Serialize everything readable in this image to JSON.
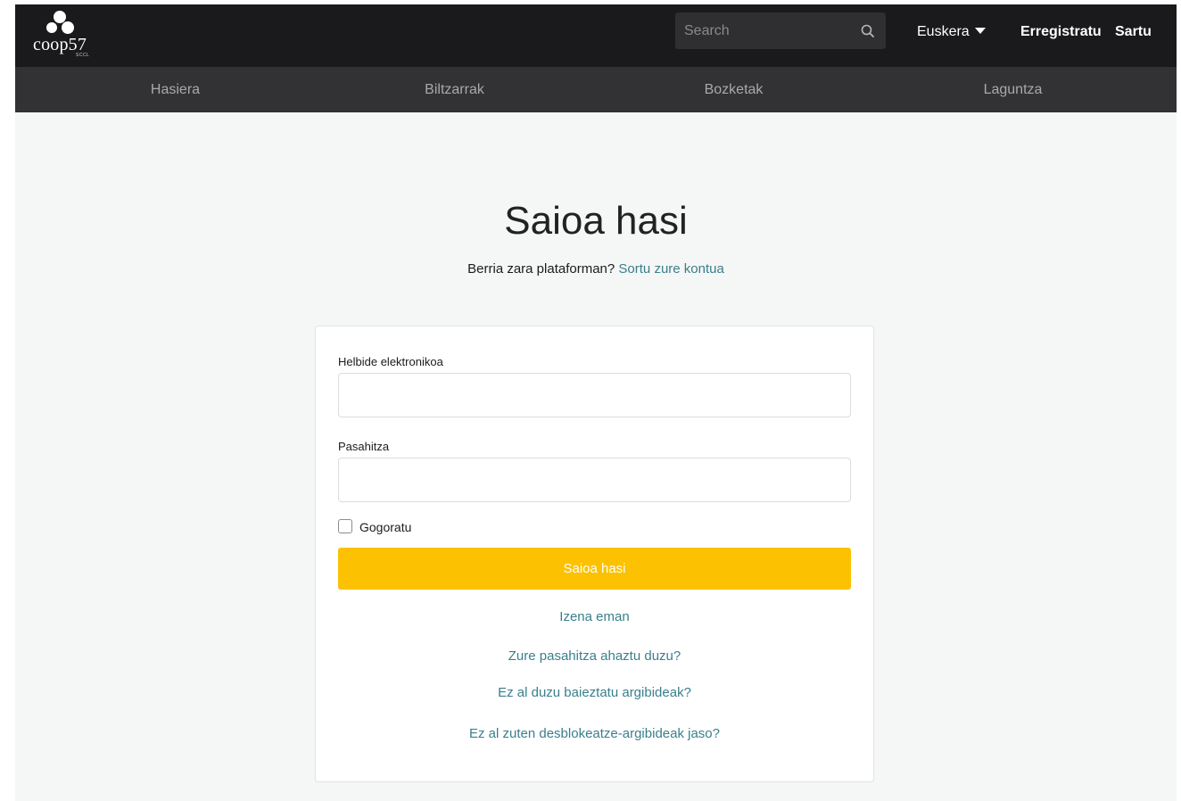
{
  "header": {
    "logo_text": "coop57",
    "logo_sub": "SCCL",
    "search": {
      "placeholder": "Search"
    },
    "language": {
      "selected": "Euskera"
    },
    "register_link": "Erregistratu",
    "signin_link": "Sartu"
  },
  "nav": {
    "items": [
      {
        "label": "Hasiera"
      },
      {
        "label": "Biltzarrak"
      },
      {
        "label": "Bozketak"
      },
      {
        "label": "Laguntza"
      }
    ]
  },
  "main": {
    "title": "Saioa hasi",
    "subtitle_text": "Berria zara plataforman?",
    "subtitle_link": "Sortu zure kontua"
  },
  "form": {
    "email_label": "Helbide elektronikoa",
    "email_value": "",
    "password_label": "Pasahitza",
    "password_value": "",
    "remember_label": "Gogoratu",
    "remember_checked": false,
    "submit_label": "Saioa hasi"
  },
  "links": {
    "register": "Izena eman",
    "forgot_password": "Zure pasahitza ahaztu duzu?",
    "confirmation": "Ez al duzu baieztatu argibideak?",
    "unlock": "Ez al zuten desblokeatze-argibideak jaso?"
  },
  "colors": {
    "topbar_bg": "#1a1a1c",
    "subnav_bg": "#323234",
    "page_bg": "#f5f6f6",
    "accent_yellow": "#fcc100",
    "link_teal": "#3a7f8c"
  },
  "icons": {
    "search": "search-icon",
    "language_dropdown": "caret-down-icon",
    "logo": "coop57-logo-icon"
  }
}
